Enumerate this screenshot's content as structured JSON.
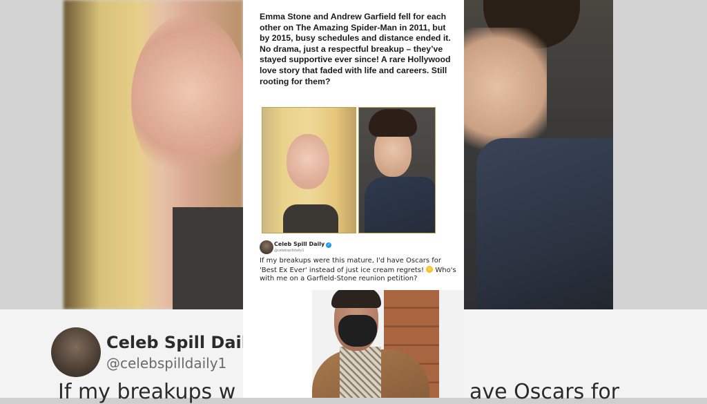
{
  "post": {
    "caption": "Emma Stone and Andrew Garfield fell for each other on The Amazing Spider-Man in 2011, but by 2015, busy schedules and distance ended it. No drama, just a respectful breakup – they’ve stayed supportive ever since! A rare Hollywood love story that faded with life and careers. Still rooting for them?"
  },
  "tweet": {
    "name": "Celeb Spill Daily",
    "handle": "@celebspilldaily1",
    "text": "If my breakups were this mature, I'd have Oscars for 'Best Ex Ever' instead of just ice cream regrets!",
    "text_cont": "Who's with me on a Garfield-Stone reunion petition?",
    "emoji": "laughing-tears-emoji"
  },
  "background_zoom": {
    "name": "Celeb Spill Daily",
    "handle": "@celebspilldaily1",
    "text_left": "If my breakups w",
    "text_right": "ave Oscars for"
  },
  "colors": {
    "verified": "#1d9bf0",
    "card_bg": "#ffffff",
    "backdrop": "#d3d3d3"
  }
}
